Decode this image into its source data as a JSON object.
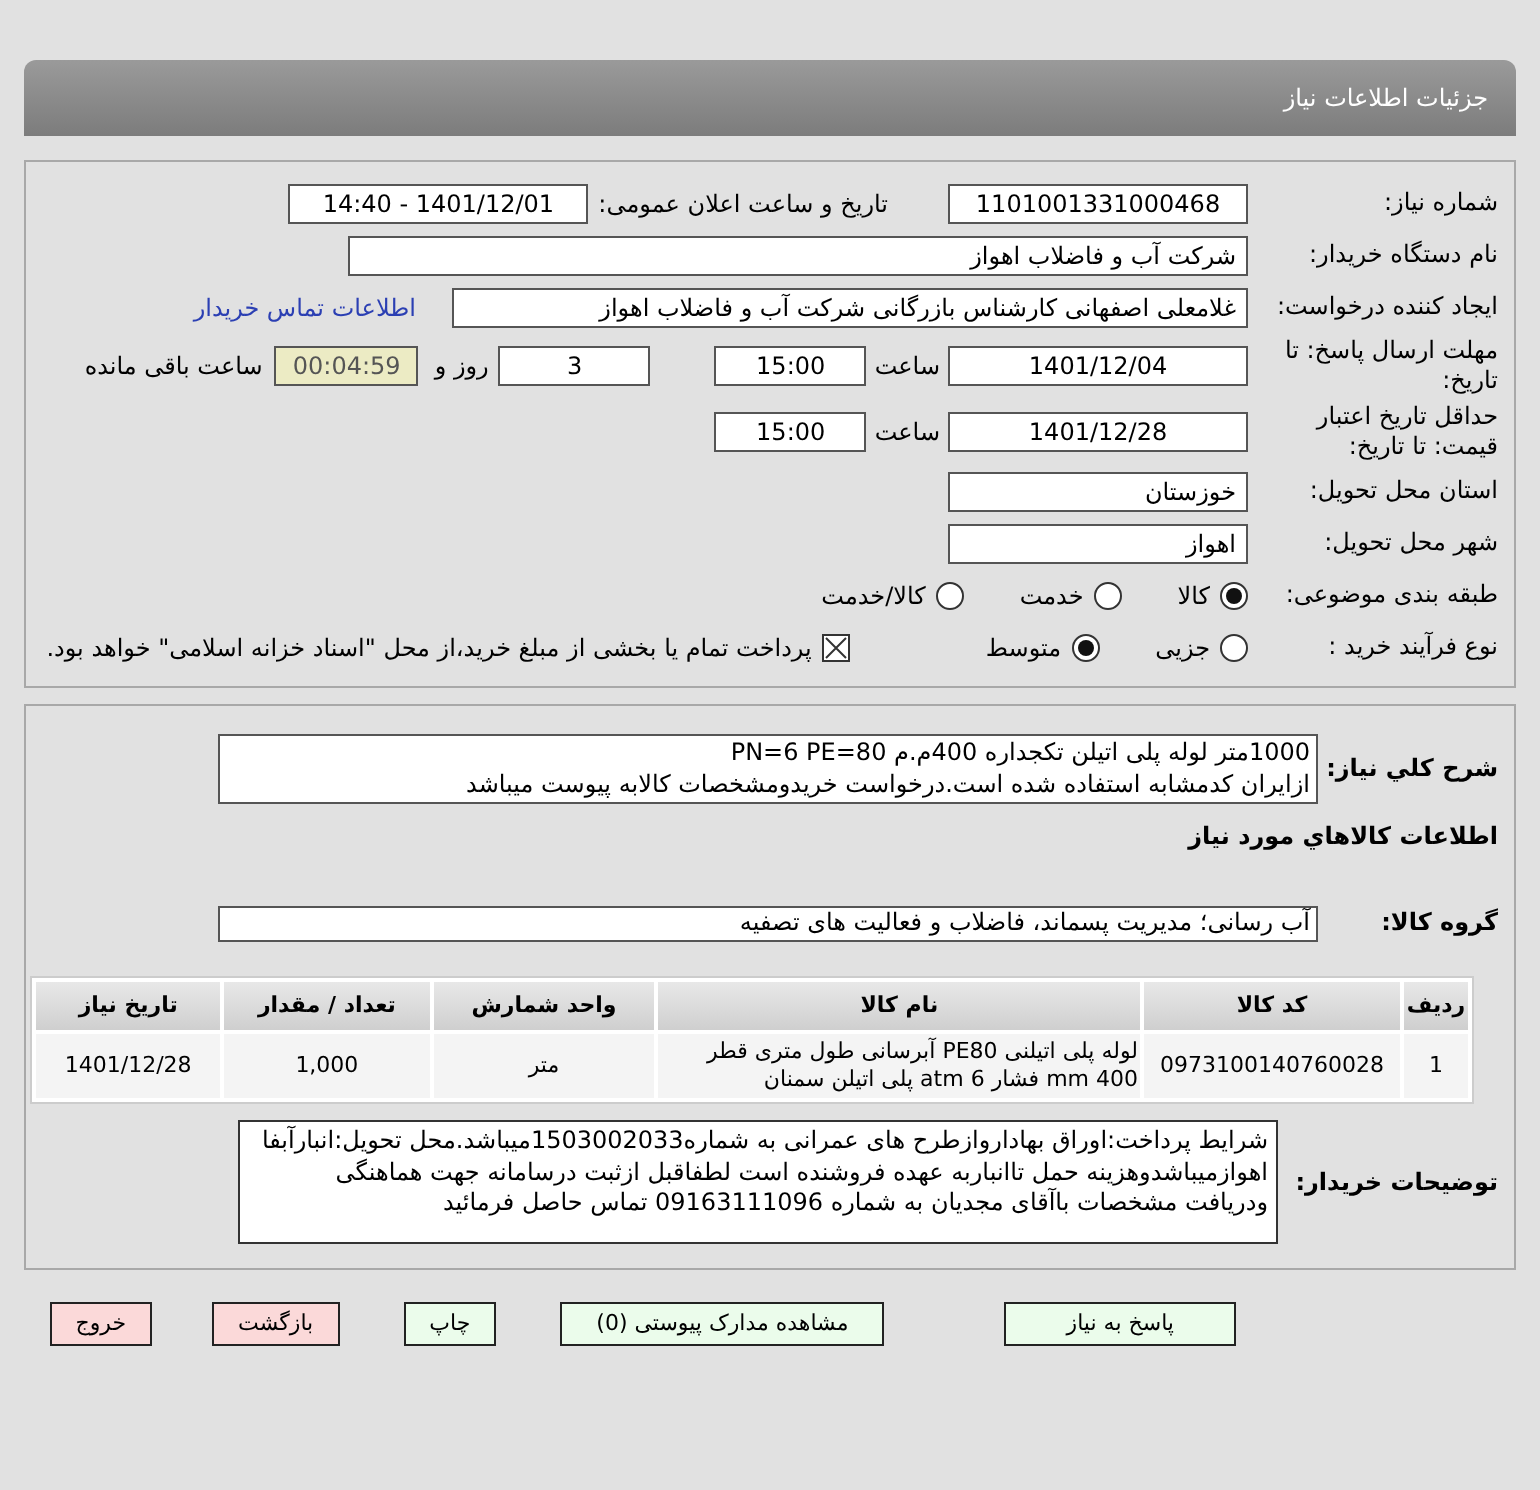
{
  "header": {
    "title": "جزئیات اطلاعات نیاز"
  },
  "need_number": {
    "label": "شماره نیاز:",
    "value": "1101001331000468"
  },
  "announce": {
    "label": "تاریخ و ساعت اعلان عمومی:",
    "value": "1401/12/01 - 14:40"
  },
  "buyer_org": {
    "label": "نام دستگاه خریدار:",
    "value": "شرکت آب و فاضلاب اهواز"
  },
  "requester": {
    "label": "ایجاد کننده درخواست:",
    "value": "غلامعلی اصفهانی کارشناس بازرگانی شرکت آب و فاضلاب اهواز",
    "link": "اطلاعات تماس خریدار"
  },
  "reply_deadline": {
    "label": "مهلت ارسال پاسخ: تا تاریخ:",
    "date": "1401/12/04",
    "time_label": "ساعت",
    "time": "15:00",
    "days": "3",
    "days_label": "روز و",
    "remaining": "00:04:59",
    "remaining_label": "ساعت باقی مانده"
  },
  "validity": {
    "label": "حداقل تاریخ اعتبار قیمت: تا تاریخ:",
    "date": "1401/12/28",
    "time_label": "ساعت",
    "time": "15:00"
  },
  "province": {
    "label": "استان محل تحویل:",
    "value": "خوزستان"
  },
  "city": {
    "label": "شهر محل تحویل:",
    "value": "اهواز"
  },
  "category": {
    "label": "طبقه بندی موضوعی:",
    "options": [
      {
        "label": "کالا",
        "selected": true
      },
      {
        "label": "خدمت",
        "selected": false
      },
      {
        "label": "کالا/خدمت",
        "selected": false
      }
    ]
  },
  "process": {
    "label": "نوع فرآیند خرید :",
    "options": [
      {
        "label": "جزیی",
        "selected": false
      },
      {
        "label": "متوسط",
        "selected": true
      }
    ],
    "payment": {
      "text": "پرداخت تمام یا بخشی از مبلغ خرید،از محل \"اسناد خزانه اسلامی\" خواهد بود.",
      "checked": true
    }
  },
  "summary": {
    "label": "شرح کلي نياز:",
    "lines": [
      "1000متر لوله پلی اتیلن تکجداره 400م.م PN=6  PE=80",
      "ازایران کدمشابه استفاده شده است.درخواست خریدومشخصات کالابه پیوست میباشد"
    ]
  },
  "goods_heading": "اطلاعات کالاهاي مورد نياز",
  "goods_group": {
    "label": "گروه کالا:",
    "value": "آب رسانی؛ مدیریت پسماند، فاضلاب و فعالیت های تصفیه"
  },
  "table": {
    "columns": [
      "ردیف",
      "کد کالا",
      "نام کالا",
      "واحد شمارش",
      "تعداد / مقدار",
      "تاریخ نیاز"
    ],
    "rows": [
      [
        "1",
        "0973100140760028",
        "لوله پلی اتیلنی PE80 آبرسانی طول متری قطر 400 mm فشار 6 atm پلی اتیلن سمنان",
        "متر",
        "1,000",
        "1401/12/28"
      ]
    ]
  },
  "buyer_notes": {
    "label": "توضیحات خریدار:",
    "text": "شرایط پرداخت:اوراق بهاداروازطرح های عمرانی به شماره1503002033میباشد.محل تحویل:انبارآبفا اهوازمیباشدوهزینه حمل تاانباربه عهده فروشنده است لطفاقبل ازثبت درسامانه جهت هماهنگی ودریافت مشخصات باآقای مجدیان به شماره  09163111096 تماس حاصل فرمائید"
  },
  "buttons": [
    {
      "label": "پاسخ به نیاز",
      "kind": "action"
    },
    {
      "label": "مشاهده مدارک پیوستی (0)",
      "kind": "action"
    },
    {
      "label": "چاپ",
      "kind": "action"
    },
    {
      "label": "بازگشت",
      "kind": "exit"
    },
    {
      "label": "خروج",
      "kind": "exit"
    }
  ]
}
